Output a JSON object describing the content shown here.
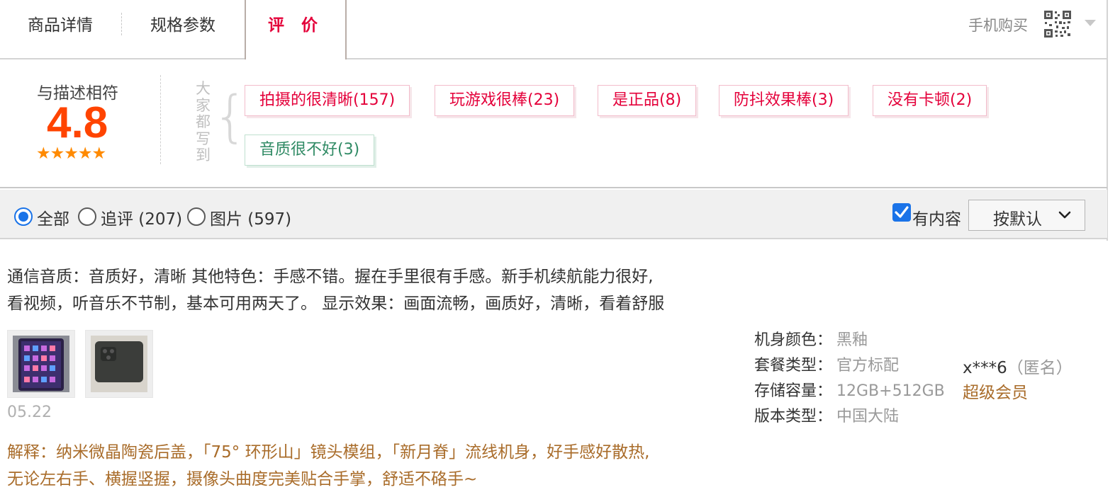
{
  "tabs": {
    "detail": "商品详情",
    "spec": "规格参数",
    "review": "评 价"
  },
  "mobile_buy": "手机购买",
  "summary": {
    "label": "与描述相符",
    "score": "4.8",
    "stars": "★★★★★",
    "everyone_wrote": "大家都写到"
  },
  "tags": [
    {
      "label": "拍摄的很清晰(157)",
      "sentiment": "positive"
    },
    {
      "label": "玩游戏很棒(23)",
      "sentiment": "positive"
    },
    {
      "label": "是正品(8)",
      "sentiment": "positive"
    },
    {
      "label": "防抖效果棒(3)",
      "sentiment": "positive"
    },
    {
      "label": "没有卡顿(2)",
      "sentiment": "positive"
    },
    {
      "label": "音质很不好(3)",
      "sentiment": "negative"
    }
  ],
  "filters": {
    "all": "全部",
    "followup": "追评 (207)",
    "pictures": "图片 (597)",
    "has_content": "有内容",
    "sort": "按默认"
  },
  "review": {
    "line1": "通信音质：音质好，清晰 其他特色：手感不错。握在手里很有手感。新手机续航能力很好,",
    "line2": "看视频，听音乐不节制，基本可用两天了。 显示效果：画面流畅，画质好，清晰，看着舒服",
    "date": "05.22",
    "reply_line1": "解释：纳米微晶陶瓷后盖，「75° 环形山」镜头模组，「新月脊」流线机身，好手感好散热,",
    "reply_line2": "无论左右手、横握竖握，摄像头曲度完美贴合手掌，舒适不硌手~",
    "specs": [
      {
        "key": "机身颜色：",
        "value": "黑釉"
      },
      {
        "key": "套餐类型：",
        "value": "官方标配"
      },
      {
        "key": "存储容量：",
        "value": "12GB+512GB"
      },
      {
        "key": "版本类型：",
        "value": "中国大陆"
      }
    ],
    "user": "x***6",
    "anonymous": "（匿名）",
    "member_level": "超级会员"
  },
  "colors": {
    "accent": "#e4003a",
    "score": "#ff4400",
    "negative_tag": "#2f8a64",
    "reply": "#a96c2a"
  }
}
